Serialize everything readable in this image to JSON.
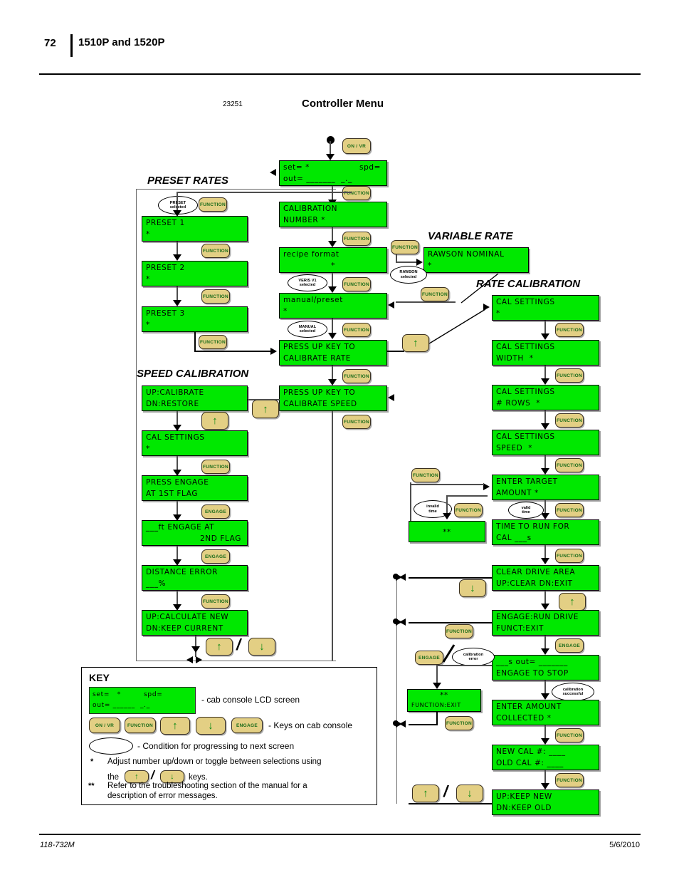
{
  "page": {
    "number": "72",
    "running_head": "1510P and 1520P",
    "footer_left": "118-732M",
    "footer_right": "5/6/2010"
  },
  "figure": {
    "number": "23251",
    "title": "Controller Menu"
  },
  "sections": {
    "preset_rates": "PRESET RATES",
    "speed_calibration": "SPEED CALIBRATION",
    "variable_rate": "VARIABLE RATE",
    "rate_calibration": "RATE CALIBRATION"
  },
  "buttons": {
    "on_vr": "ON / VR",
    "function": "FUNCTION",
    "engage": "ENGAGE",
    "up": "↑",
    "down": "↓",
    "slash": "/"
  },
  "conditions": {
    "preset_selected": [
      "PRESET",
      "selected"
    ],
    "veris_selected": [
      "VERIS V1",
      "selected"
    ],
    "manual_selected": [
      "MANUAL",
      "selected"
    ],
    "rawson_selected": [
      "RAWSON",
      "selected"
    ],
    "invalid_time": [
      "invalid",
      "time"
    ],
    "valid_time": [
      "valid",
      "time"
    ],
    "calibration_error": [
      "calibration",
      "error"
    ],
    "calibration_successful": [
      "calibration",
      "successful"
    ]
  },
  "screens": {
    "main": {
      "l1": "set= *",
      "l1r": "spd=",
      "l2": "out= _______  _._"
    },
    "cal_number": {
      "l1": "CALIBRATION",
      "l2": "NUMBER *"
    },
    "recipe_format": {
      "l1": "recipe format",
      "l2": "*"
    },
    "manual_preset": {
      "l1": "manual/preset",
      "l2": "*"
    },
    "press_up_rate": {
      "l1": "PRESS UP KEY TO",
      "l2": "CALIBRATE RATE"
    },
    "preset1": {
      "l1": "PRESET 1",
      "l2": "*"
    },
    "preset2": {
      "l1": "PRESET 2",
      "l2": "*"
    },
    "preset3": {
      "l1": "PRESET 3",
      "l2": "*"
    },
    "rawson_nominal": {
      "l1": "RAWSON NOMINAL",
      "l2": "*"
    },
    "press_up_speed": {
      "l1": "PRESS UP KEY TO",
      "l2": "CALIBRATE SPEED"
    },
    "up_cal_dn_restore": {
      "l1": "UP:CALIBRATE",
      "l2": "DN:RESTORE"
    },
    "cal_settings_spd": {
      "l1": "CAL SETTINGS",
      "l2": "*"
    },
    "press_engage_1st": {
      "l1": "PRESS ENGAGE",
      "l2": "AT 1ST FLAG"
    },
    "ft_engage_2nd": {
      "l1": "___ft ENGAGE AT",
      "l2": "2ND FLAG"
    },
    "distance_error": {
      "l1": "DISTANCE ERROR",
      "l2": "___%"
    },
    "calc_new_keep": {
      "l1": "UP:CALCULATE NEW",
      "l2": "DN:KEEP CURRENT"
    },
    "cal_settings": {
      "l1": "CAL SETTINGS",
      "l2": "*"
    },
    "cal_width": {
      "l1": "CAL SETTINGS",
      "l2": "WIDTH  *"
    },
    "cal_rows": {
      "l1": "CAL SETTINGS",
      "l2": "# ROWS  *"
    },
    "cal_speed": {
      "l1": "CAL SETTINGS",
      "l2": "SPEED  *"
    },
    "enter_target": {
      "l1": "ENTER TARGET",
      "l2": "AMOUNT *"
    },
    "time_to_run": {
      "l1": "TIME TO RUN FOR",
      "l2": "CAL ___s"
    },
    "clear_drive": {
      "l1": "CLEAR DRIVE AREA",
      "l2": "UP:CLEAR DN:EXIT"
    },
    "engage_run": {
      "l1": "ENGAGE:RUN DRIVE",
      "l2": "FUNCT:EXIT"
    },
    "s_out_engage": {
      "l1": "___s out= _______",
      "l2": "ENGAGE TO STOP"
    },
    "enter_amount": {
      "l1": "ENTER AMOUNT",
      "l2": "COLLECTED *"
    },
    "new_old_cal": {
      "l1": "NEW CAL #: ____",
      "l2": "OLD CAL #: ____"
    },
    "keep_new_old": {
      "l1": "UP:KEEP NEW",
      "l2": "DN:KEEP OLD"
    },
    "error_time": {
      "l1": "**",
      "l2": ""
    },
    "error_cal": {
      "l1": "**",
      "l2": "FUNCTION:EXIT"
    }
  },
  "key": {
    "title": "KEY",
    "lcd_l1": "set=   *         spd=",
    "lcd_l2": "out= ______  _._",
    "lcd_desc": "- cab console LCD screen",
    "keys_desc": "- Keys on cab console",
    "oval_desc": "- Condition for progressing to next screen",
    "note1_mark": "*",
    "note1_a": "Adjust number up/down or toggle between selections using",
    "note1_b": "the",
    "note1_c": "keys.",
    "note2_mark": "**",
    "note2_a": "Refer to the troubleshooting section of the manual for a",
    "note2_b": "description of error messages."
  },
  "colors": {
    "lcd_green": "#00e800",
    "button_tan": "#e3cf84",
    "button_text_green": "#1a6b1a",
    "connector_gray": "#4d4d4d"
  }
}
